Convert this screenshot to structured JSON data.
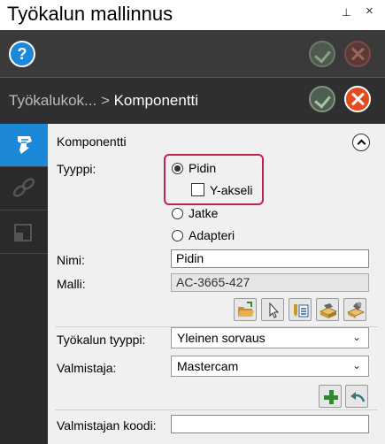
{
  "window": {
    "title": "Työkalun mallinnus",
    "pin_glyph": "⊥",
    "close_glyph": "×"
  },
  "toolbar": {
    "help_glyph": "?"
  },
  "breadcrumb": {
    "parent": "Työkalukok...",
    "separator": " > ",
    "current": "Komponentti"
  },
  "section": {
    "title": "Komponentti"
  },
  "form": {
    "type_label": "Tyyppi:",
    "type_options": [
      {
        "label": "Pidin",
        "selected": true
      },
      {
        "label": "Jatke",
        "selected": false
      },
      {
        "label": "Adapteri",
        "selected": false
      }
    ],
    "y_axis_label": "Y-akseli",
    "y_axis_checked": false,
    "name_label": "Nimi:",
    "name_value": "Pidin",
    "model_label": "Malli:",
    "model_value": "AC-3665-427",
    "tool_type_label": "Työkalun tyyppi:",
    "tool_type_value": "Yleinen sorvaus",
    "manufacturer_label": "Valmistaja:",
    "manufacturer_value": "Mastercam",
    "manufacturer_code_label": "Valmistajan koodi:",
    "manufacturer_code_value": ""
  },
  "colors": {
    "accent": "#1e88d8",
    "highlight": "#c0244a",
    "cancel": "#e54a1f",
    "confirm": "#5a8a5a"
  },
  "icons": {
    "sidebar": [
      "tool-holder-icon",
      "link-chain-icon",
      "layers-icon"
    ],
    "model_actions": [
      "open-folder-icon",
      "select-pointer-icon",
      "list-table-icon",
      "component-library-icon",
      "edit-component-icon"
    ],
    "manufacturer_actions": [
      "add-icon",
      "undo-icon"
    ]
  }
}
